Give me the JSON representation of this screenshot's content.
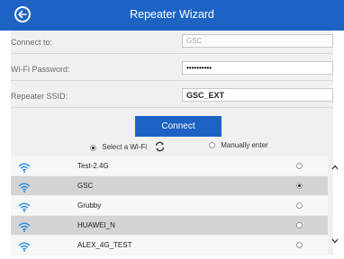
{
  "header": {
    "title": "Repeater Wizard"
  },
  "form": {
    "connect_label": "Connect to:",
    "connect_value": "GSC",
    "password_label": "Wi-Fi Password:",
    "password_value": "••••••••••",
    "ssid_label": "Repeater SSID:",
    "ssid_value": "GSC_EXT"
  },
  "connect_button": "Connect",
  "options": {
    "select_wifi": "Select a Wi-Fi",
    "manual": "Manually enter"
  },
  "networks": [
    {
      "ssid": "Test-2.4G",
      "selected": false
    },
    {
      "ssid": "GSC",
      "selected": true
    },
    {
      "ssid": "Grubby",
      "selected": false
    },
    {
      "ssid": "HUAWEI_N",
      "selected": false
    },
    {
      "ssid": "ALEX_4G_TEST",
      "selected": false
    }
  ],
  "colors": {
    "accent": "#1e63c4",
    "wifi": "#2f8fe0"
  }
}
